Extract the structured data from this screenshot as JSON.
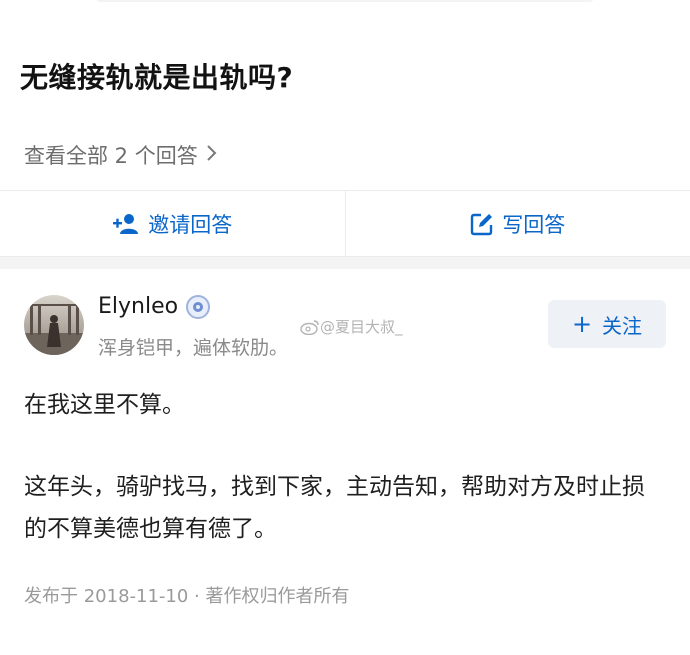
{
  "question": {
    "title": "无缝接轨就是出轨吗?",
    "view_all": "查看全部 2 个回答"
  },
  "actions": {
    "invite_label": "邀请回答",
    "write_label": "写回答"
  },
  "answer": {
    "author": {
      "name": "Elynleo",
      "bio": "浑身铠甲，遍体软肋。"
    },
    "follow_label": "关注",
    "watermark": "@夏目大叔_",
    "paragraphs": [
      "在我这里不算。",
      "这年头，骑驴找马，找到下家，主动告知，帮助对方及时止损的不算美德也算有德了。"
    ],
    "meta": "发布于 2018-11-10 · 著作权归作者所有"
  },
  "colors": {
    "accent": "#0a66c9",
    "muted": "#8a8a8a"
  },
  "icons": [
    "add-user-icon",
    "edit-icon",
    "chevron-right-icon",
    "plus-icon",
    "badge-icon",
    "weibo-icon"
  ]
}
